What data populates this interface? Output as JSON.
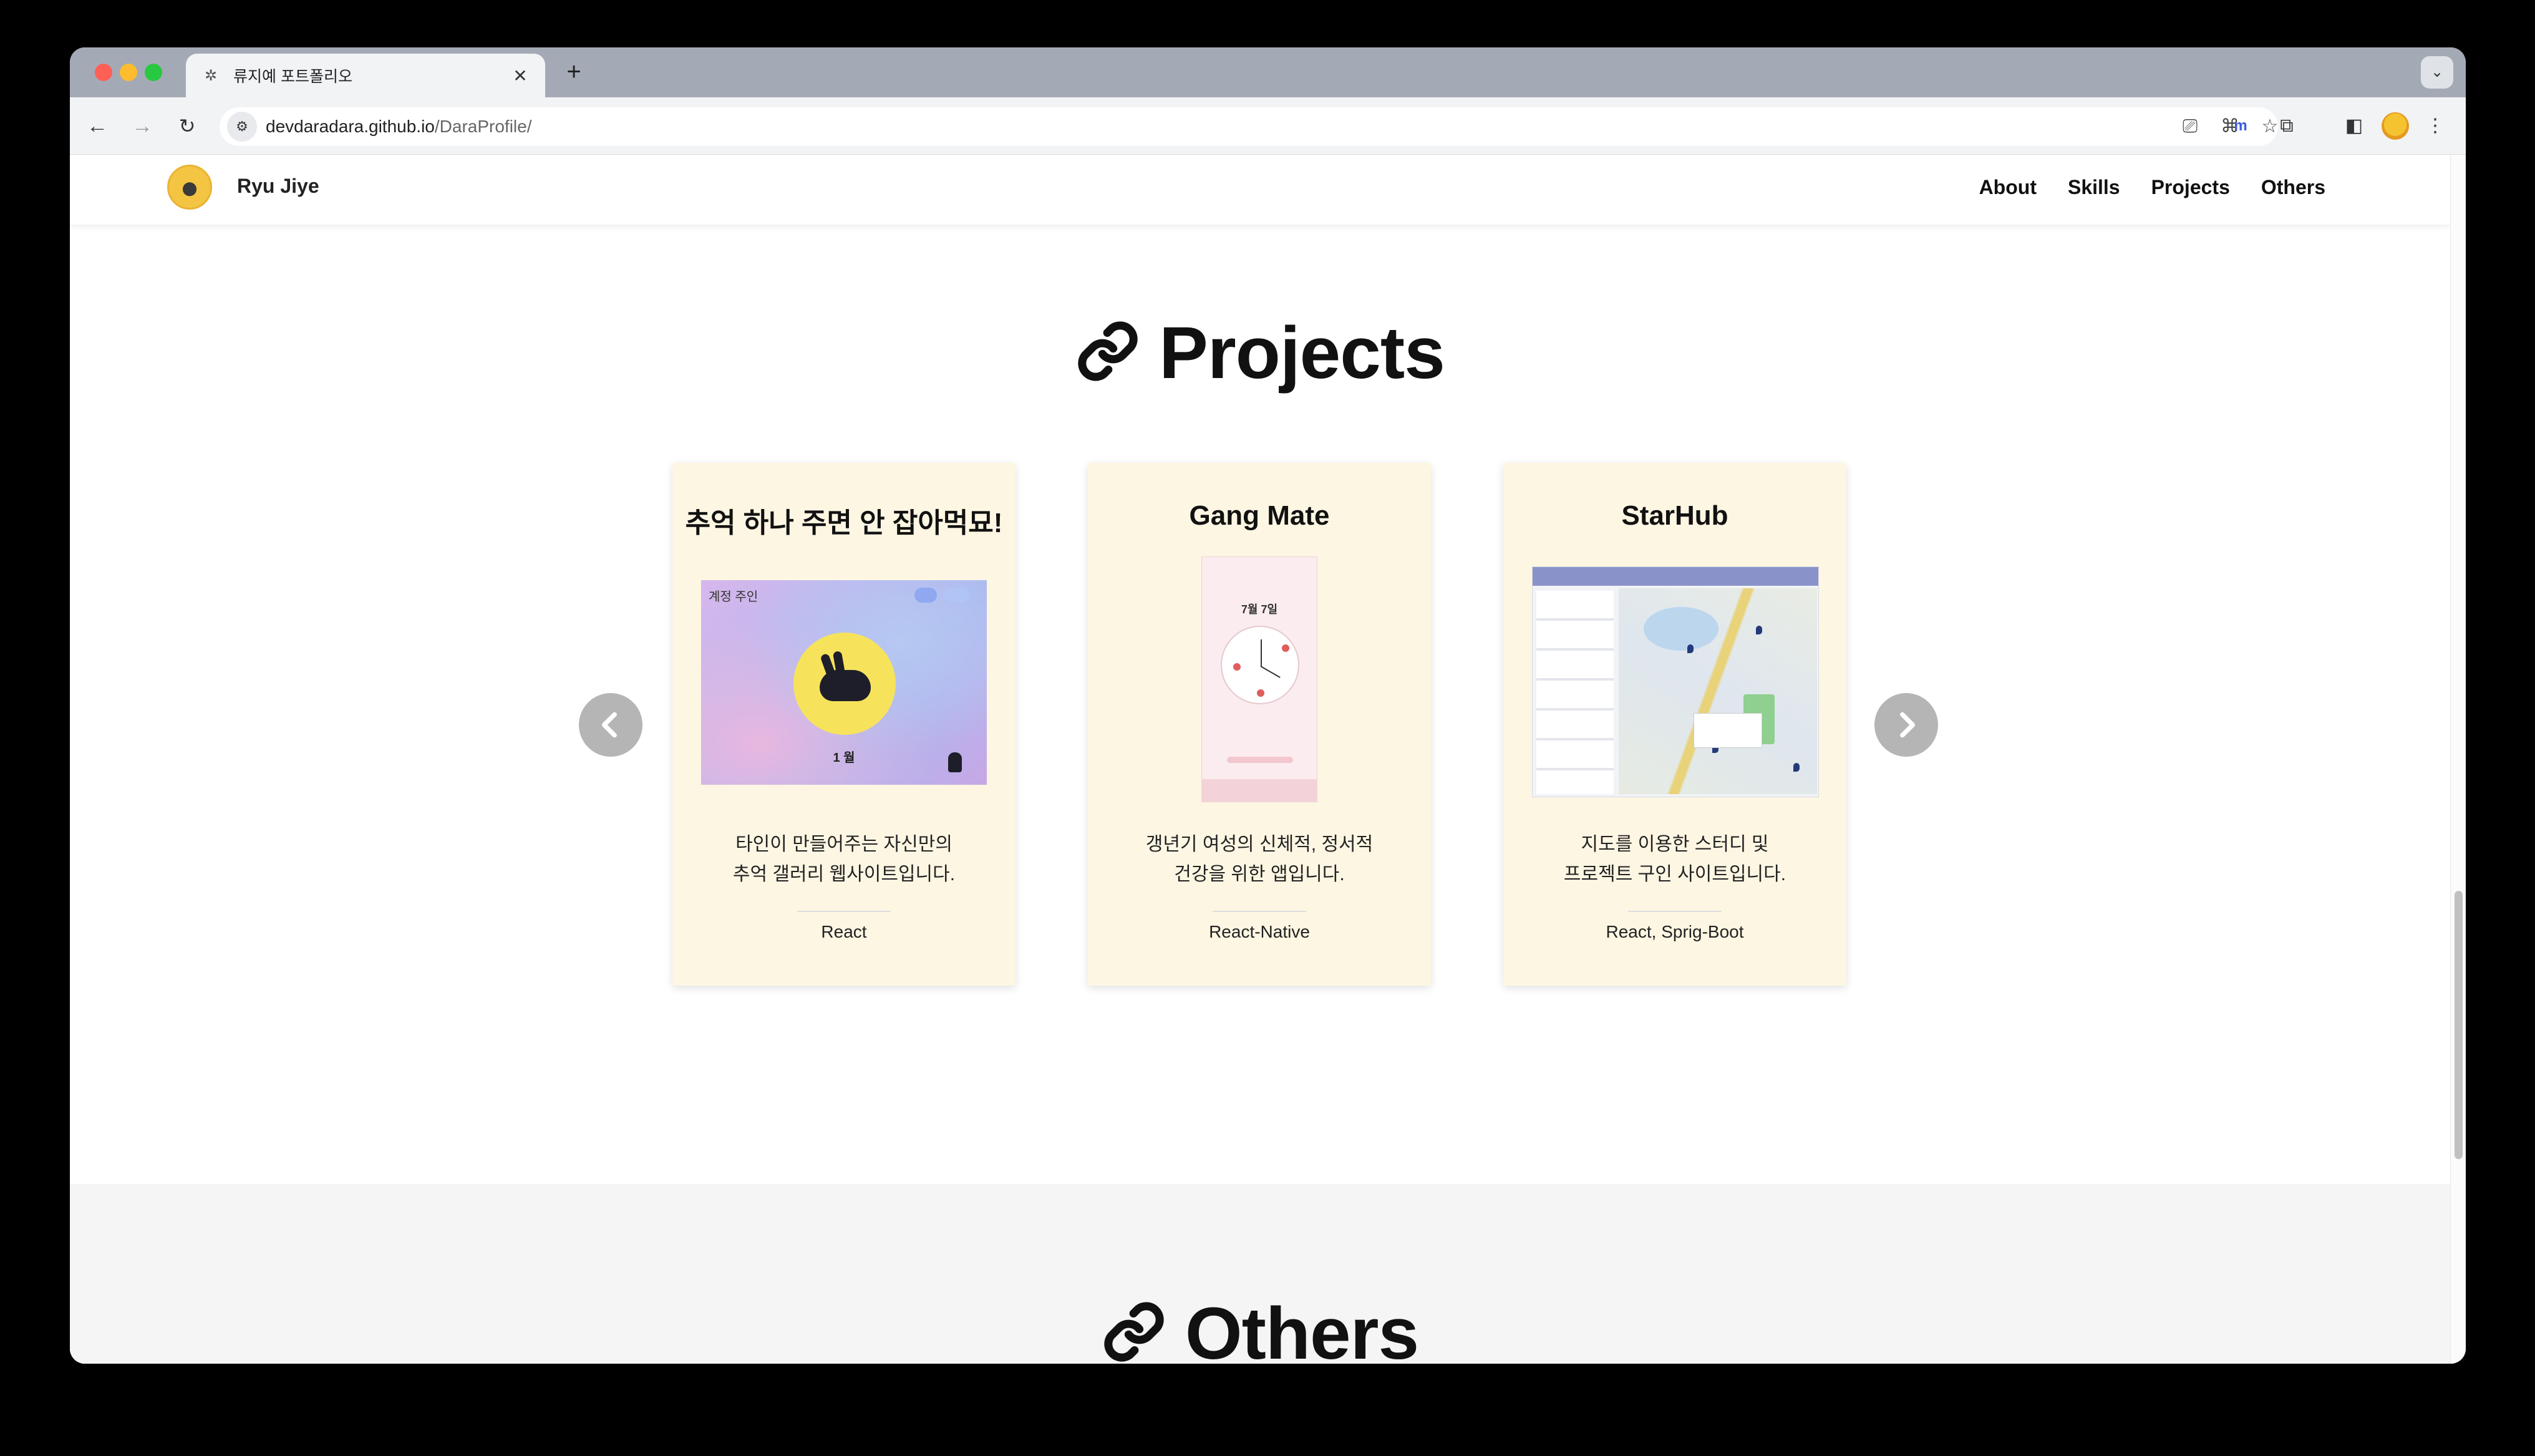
{
  "browser": {
    "tab_title": "류지예 포트폴리오",
    "tab_close": "✕",
    "new_tab": "+",
    "url_host": "devdaradara.github.io",
    "url_path": "/DaraProfile/"
  },
  "site": {
    "brand_name": "Ryu Jiye",
    "nav": [
      "About",
      "Skills",
      "Projects",
      "Others"
    ]
  },
  "projects": {
    "title": "Projects",
    "cards": [
      {
        "title": "추억 하나 주면 안 잡아먹묘!",
        "description_line1": "타인이 만들어주는 자신만의",
        "description_line2": "추억 갤러리 웹사이트입니다.",
        "tech": "React",
        "thumb": {
          "label": "계정 주인",
          "month": "1 월"
        }
      },
      {
        "title": "Gang Mate",
        "description_line1": "갱년기 여성의 신체적, 정서적",
        "description_line2": "건강을 위한 앱입니다.",
        "tech": "React-Native",
        "thumb": {
          "date": "7월 7일"
        }
      },
      {
        "title": "StarHub",
        "description_line1": "지도를 이용한 스터디 및",
        "description_line2": "프로젝트 구인 사이트입니다.",
        "tech": "React, Sprig-Boot",
        "thumb": {}
      }
    ]
  },
  "others": {
    "title": "Others"
  },
  "colors": {
    "card_bg": "#fdf6e3",
    "carousel_btn": "#b5b5b5",
    "others_bg": "#f5f5f5"
  }
}
